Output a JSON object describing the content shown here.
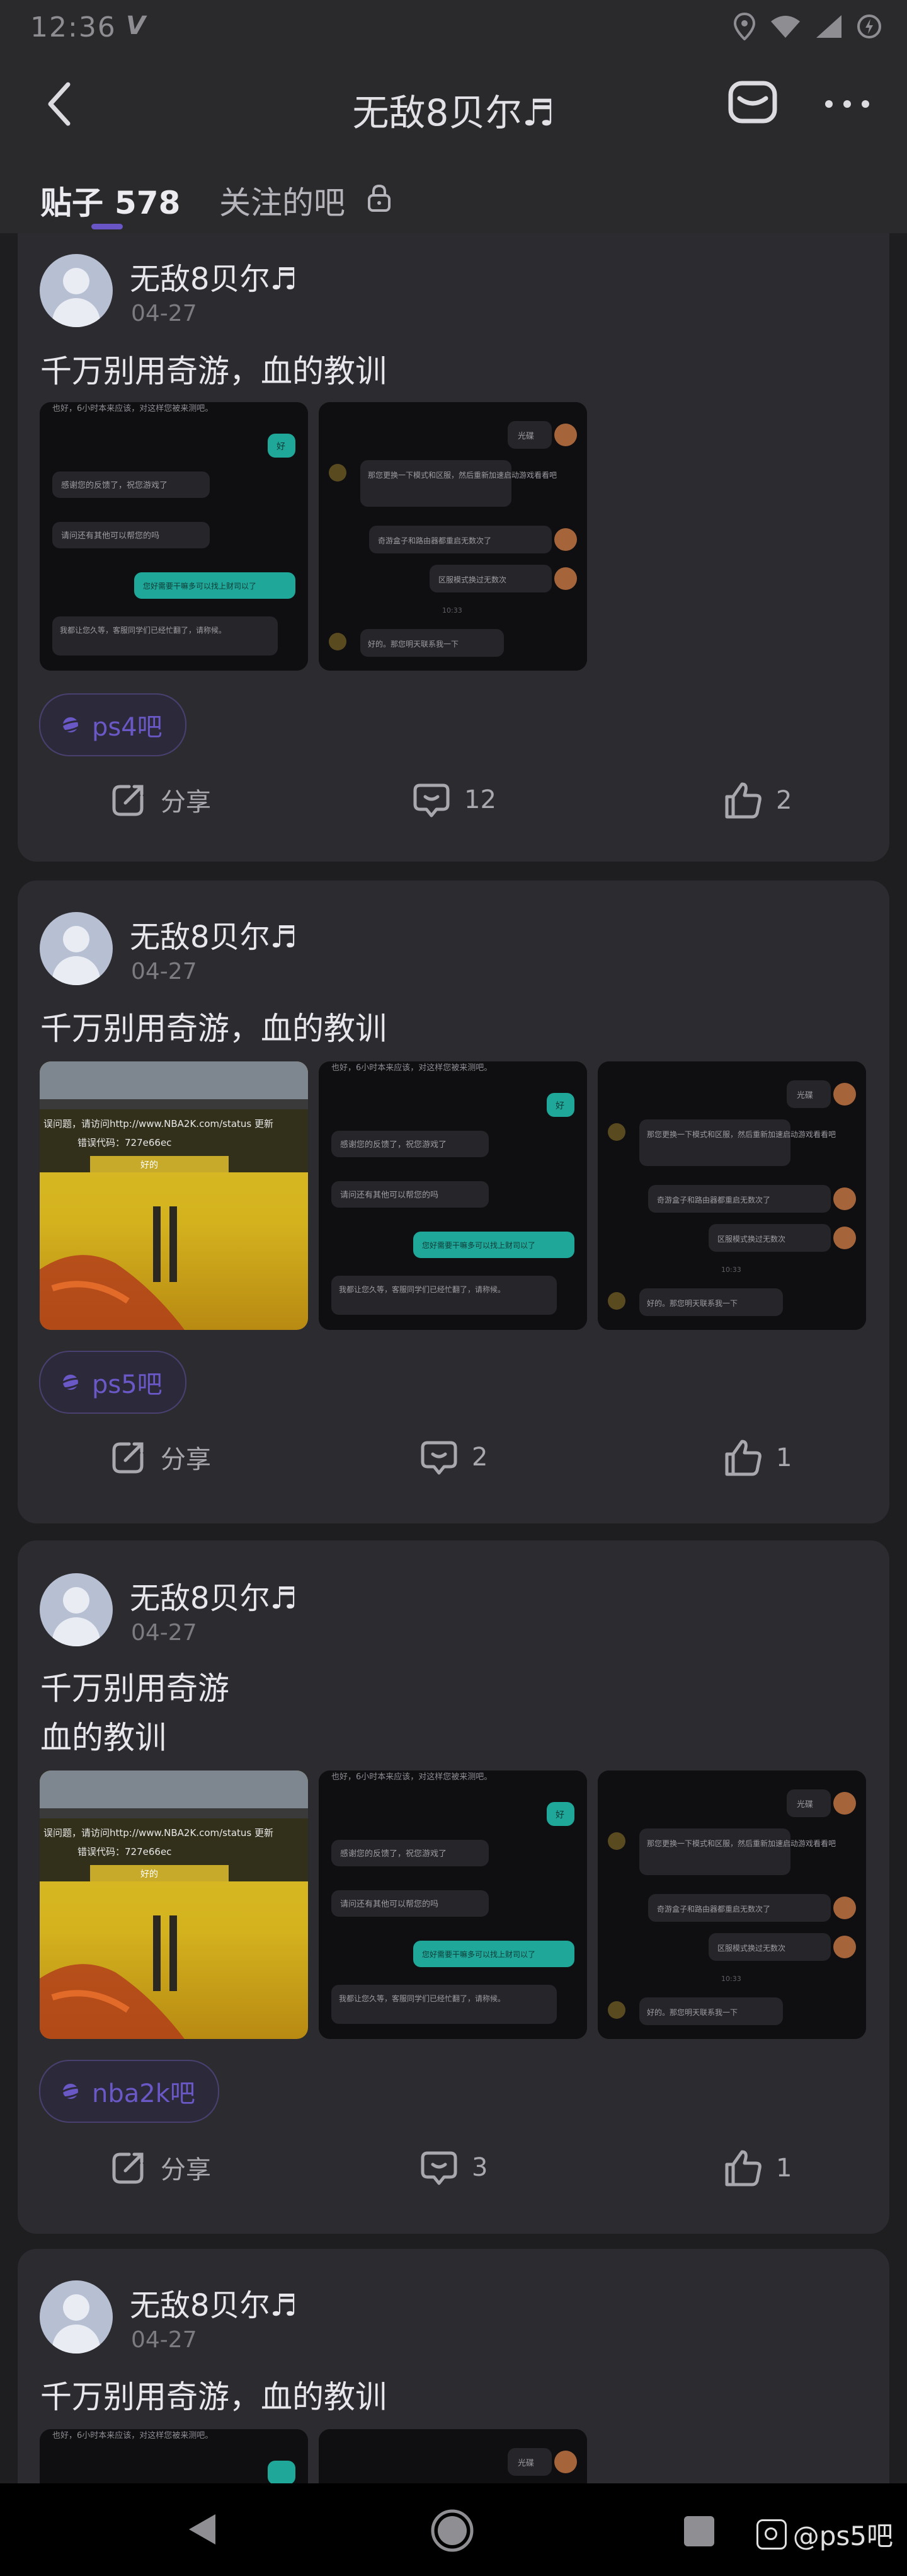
{
  "status_bar": {
    "time": "12:36",
    "carrier_mark": "V"
  },
  "app_bar": {
    "title": "无敌8贝尔♬"
  },
  "tabs": {
    "posts_label": "贴子",
    "posts_count": "578",
    "follow_label": "关注的吧"
  },
  "posts": [
    {
      "username": "无敌8贝尔♬",
      "date": "04-27",
      "title": "千万别用奇游，血的教训",
      "forum": "ps4吧",
      "share": "分享",
      "comments": "12",
      "likes": "2"
    },
    {
      "username": "无敌8贝尔♬",
      "date": "04-27",
      "title": "千万别用奇游，血的教训",
      "forum": "ps5吧",
      "share": "分享",
      "comments": "2",
      "likes": "1"
    },
    {
      "username": "无敌8贝尔♬",
      "date": "04-27",
      "title": "千万别用奇游\n血的教训",
      "forum": "nba2k吧",
      "share": "分享",
      "comments": "3",
      "likes": "1"
    },
    {
      "username": "无敌8贝尔♬",
      "date": "04-27",
      "title": "千万别用奇游，血的教训"
    }
  ],
  "screenshots": {
    "chat_a": {
      "top": "也好，6小时本来应该，对这样您被来测吧。",
      "bubble_teal": "好",
      "m1": "感谢您的反馈了，祝您游戏了",
      "m2": "请问还有其他可以帮您的吗",
      "teal2": "您好需要干嘛多可以找上财司以了",
      "m3": "我都让您久等，客服同学们已经忙翻了，请称候。"
    },
    "chat_b": {
      "r1": "光碟",
      "l1": "那您更换一下模式和区服，然后重新加速启动游戏看看吧",
      "r2": "奇游盒子和路由器都重启无数次了",
      "r3": "区服模式换过无数次",
      "time": "10:33",
      "l2": "好的。那您明天联系我一下"
    },
    "error": {
      "line1": "误问题，请访问http://www.NBA2K.com/status 更新",
      "line2": "错误代码：727e66ec",
      "button": "好的"
    }
  },
  "nav": {
    "watermark": "@ps5吧"
  },
  "colors": {
    "background": "#1e1e21",
    "card": "#2c2c30",
    "accent": "#6a55c6",
    "chat_teal": "#1fa89a"
  }
}
